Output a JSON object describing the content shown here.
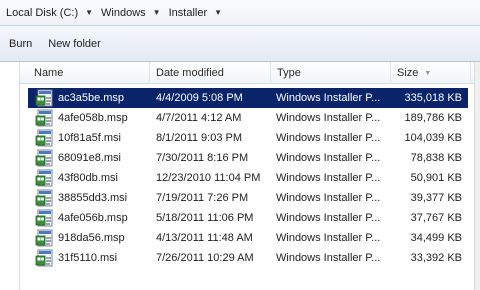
{
  "address": {
    "crumbs": [
      {
        "label": "Local Disk (C:)"
      },
      {
        "label": "Windows"
      },
      {
        "label": "Installer"
      }
    ]
  },
  "toolbar": {
    "burn_label": "Burn",
    "new_folder_label": "New folder"
  },
  "columns": {
    "name": "Name",
    "date": "Date modified",
    "type": "Type",
    "size": "Size"
  },
  "files": [
    {
      "name": "ac3a5be.msp",
      "date": "4/4/2009 5:08 PM",
      "type": "Windows Installer P...",
      "size": "335,018 KB",
      "selected": true
    },
    {
      "name": "4afe058b.msp",
      "date": "4/7/2011 4:12 AM",
      "type": "Windows Installer P...",
      "size": "189,786 KB"
    },
    {
      "name": "10f81a5f.msi",
      "date": "8/1/2011 9:03 PM",
      "type": "Windows Installer P...",
      "size": "104,039 KB"
    },
    {
      "name": "68091e8.msi",
      "date": "7/30/2011 8:16 PM",
      "type": "Windows Installer P...",
      "size": "78,838 KB"
    },
    {
      "name": "43f80db.msi",
      "date": "12/23/2010 11:04 PM",
      "type": "Windows Installer P...",
      "size": "50,901 KB"
    },
    {
      "name": "38855dd3.msi",
      "date": "7/19/2011 7:26 PM",
      "type": "Windows Installer P...",
      "size": "39,377 KB"
    },
    {
      "name": "4afe056b.msp",
      "date": "5/18/2011 11:06 PM",
      "type": "Windows Installer P...",
      "size": "37,767 KB"
    },
    {
      "name": "918da56.msp",
      "date": "4/13/2011 11:48 AM",
      "type": "Windows Installer P...",
      "size": "34,499 KB"
    },
    {
      "name": "31f5110.msi",
      "date": "7/26/2011 10:29 AM",
      "type": "Windows Installer P...",
      "size": "33,392 KB"
    }
  ],
  "icons": {
    "crumb_arrow": "chevron-down-icon",
    "sort": "sort-down-icon",
    "file": "msi-installer-icon"
  },
  "colors": {
    "selection": "#0a246a"
  }
}
